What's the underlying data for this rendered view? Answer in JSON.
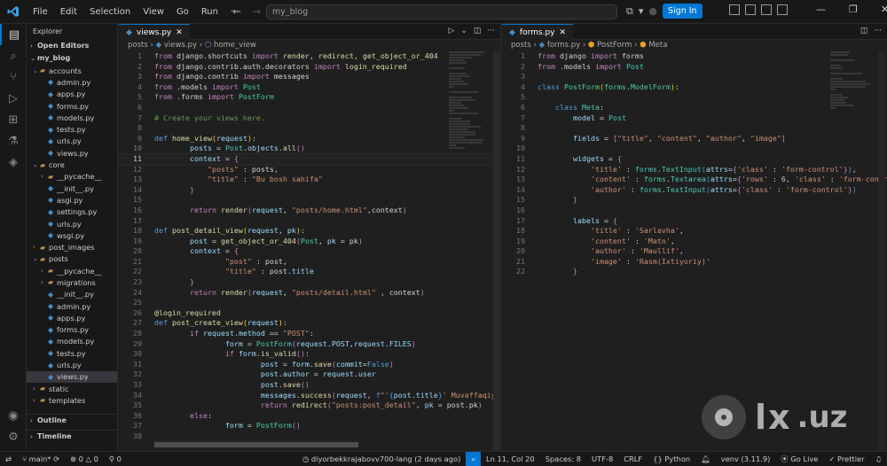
{
  "titlebar": {
    "menu": [
      "File",
      "Edit",
      "Selection",
      "View",
      "Go",
      "Run",
      "···"
    ],
    "search": "my_blog",
    "signin": "Sign In"
  },
  "sidebar": {
    "title": "Explorer",
    "open_editors": "Open Editors",
    "root": "my_blog",
    "tree": [
      {
        "label": "accounts",
        "type": "folder",
        "depth": 1,
        "open": true
      },
      {
        "label": "admin.py",
        "type": "py",
        "depth": 2
      },
      {
        "label": "apps.py",
        "type": "py",
        "depth": 2
      },
      {
        "label": "forms.py",
        "type": "py",
        "depth": 2
      },
      {
        "label": "models.py",
        "type": "py",
        "depth": 2
      },
      {
        "label": "tests.py",
        "type": "py",
        "depth": 2
      },
      {
        "label": "urls.py",
        "type": "py",
        "depth": 2
      },
      {
        "label": "views.py",
        "type": "py",
        "depth": 2
      },
      {
        "label": "core",
        "type": "folder",
        "depth": 1,
        "open": true
      },
      {
        "label": "__pycache__",
        "type": "folder",
        "depth": 2,
        "open": false
      },
      {
        "label": "__init__.py",
        "type": "py",
        "depth": 2
      },
      {
        "label": "asgi.py",
        "type": "py",
        "depth": 2
      },
      {
        "label": "settings.py",
        "type": "py",
        "depth": 2
      },
      {
        "label": "urls.py",
        "type": "py",
        "depth": 2
      },
      {
        "label": "wsgi.py",
        "type": "py",
        "depth": 2
      },
      {
        "label": "post_images",
        "type": "folder",
        "depth": 1,
        "open": false
      },
      {
        "label": "posts",
        "type": "folder",
        "depth": 1,
        "open": true
      },
      {
        "label": "__pycache__",
        "type": "folder",
        "depth": 2,
        "open": false
      },
      {
        "label": "migrations",
        "type": "folder",
        "depth": 2,
        "open": false
      },
      {
        "label": "__init__.py",
        "type": "py",
        "depth": 2
      },
      {
        "label": "admin.py",
        "type": "py",
        "depth": 2
      },
      {
        "label": "apps.py",
        "type": "py",
        "depth": 2
      },
      {
        "label": "forms.py",
        "type": "py",
        "depth": 2
      },
      {
        "label": "models.py",
        "type": "py",
        "depth": 2
      },
      {
        "label": "tests.py",
        "type": "py",
        "depth": 2
      },
      {
        "label": "urls.py",
        "type": "py",
        "depth": 2
      },
      {
        "label": "views.py",
        "type": "py",
        "depth": 2,
        "selected": true
      },
      {
        "label": "static",
        "type": "folder",
        "depth": 1,
        "open": false
      },
      {
        "label": "templates",
        "type": "folder",
        "depth": 1,
        "open": false
      }
    ],
    "outline": "Outline",
    "timeline": "Timeline"
  },
  "left_editor": {
    "tab": "views.py",
    "crumbs": [
      "posts",
      "views.py",
      "home_view"
    ],
    "current_line": 11
  },
  "right_editor": {
    "tab": "forms.py",
    "crumbs": [
      "posts",
      "forms.py",
      "PostForm",
      "Meta"
    ]
  },
  "statusbar": {
    "branch": "main*",
    "errors": "0",
    "warnings": "0",
    "ports": "0",
    "blame": "diyorbekkrajabovv700-lang (2 days ago)",
    "position": "Ln 11, Col 20",
    "spaces": "Spaces: 8",
    "encoding": "UTF-8",
    "eol": "CRLF",
    "language": "Python",
    "venv": "venv (3.11.9)",
    "golive": "Go Live",
    "prettier": "Prettier"
  },
  "watermark": {
    "brand": "olx",
    "suffix": ".uz"
  },
  "colors": {
    "accent": "#0078d4",
    "keyword": "#c586c0",
    "string": "#ce9178",
    "function": "#dcdcaa",
    "class": "#4ec9b0",
    "variable": "#9cdcfe",
    "comment": "#6a9955"
  }
}
